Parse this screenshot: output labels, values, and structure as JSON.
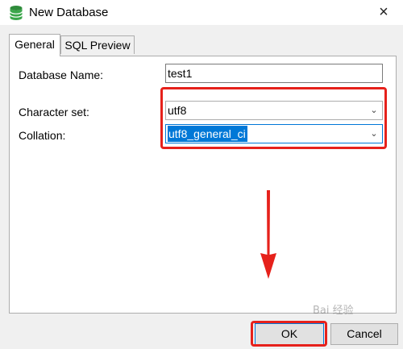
{
  "window": {
    "title": "New Database",
    "close_glyph": "×",
    "icon": "database-icon"
  },
  "tabs": [
    {
      "label": "General",
      "active": true
    },
    {
      "label": "SQL Preview",
      "active": false
    }
  ],
  "form": {
    "database_name_label": "Database Name:",
    "database_name_value": "test1",
    "character_set_label": "Character set:",
    "character_set_value": "utf8",
    "collation_label": "Collation:",
    "collation_value": "utf8_general_ci"
  },
  "buttons": {
    "ok": "OK",
    "cancel": "Cancel"
  },
  "watermark": "Bai 经验",
  "colors": {
    "annotation_red": "#e6211b",
    "selection_blue": "#0078d7",
    "db_icon_green": "#2e8b3a"
  }
}
